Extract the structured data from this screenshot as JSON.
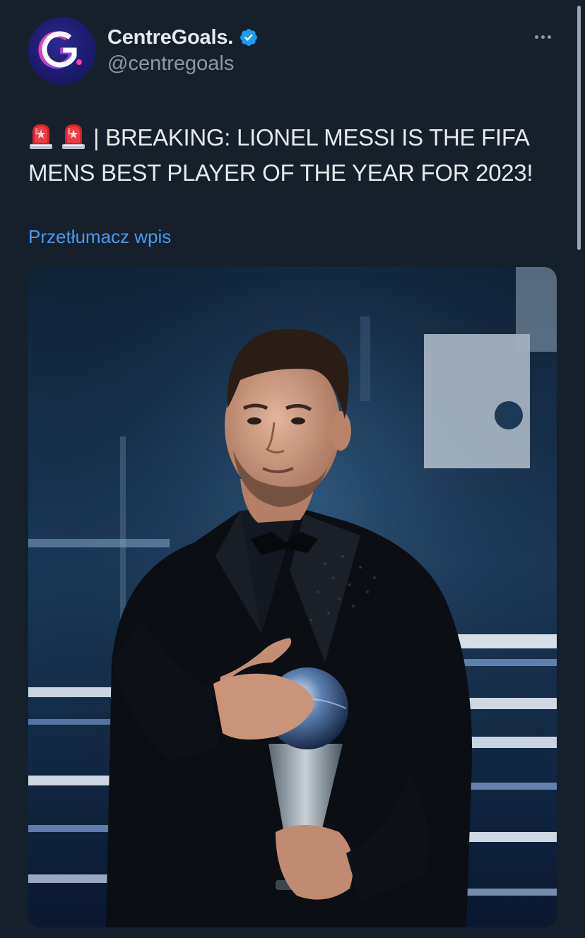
{
  "colors": {
    "background": "#15202b",
    "text_primary": "#e7e9ea",
    "text_secondary": "#8b98a5",
    "link": "#4a99e9",
    "verified": "#1d9bf0",
    "avatar_bg": "#1c1c6e"
  },
  "author": {
    "avatar_letter": "G",
    "display_name": "CentreGoals.",
    "handle": "@centregoals",
    "verified_icon": "verified-badge-icon"
  },
  "menu": {
    "icon": "more-horizontal-icon"
  },
  "tweet": {
    "icons": [
      "siren-icon",
      "siren-icon"
    ],
    "text": "| BREAKING: LIONEL MESSI IS THE FIFA MENS BEST PLAYER OF THE YEAR FOR 2023!",
    "translate_label": "Przetłumacz wpis"
  },
  "media": {
    "icon": "photo"
  }
}
